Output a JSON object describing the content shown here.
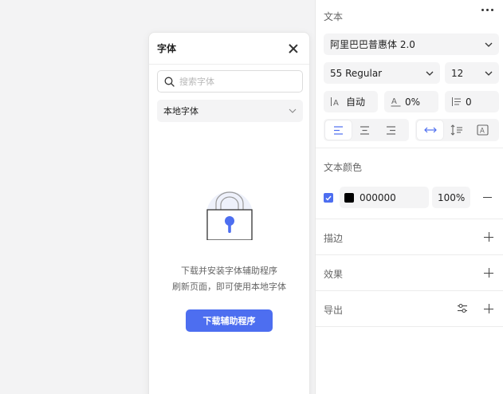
{
  "font_panel": {
    "title": "字体",
    "search_placeholder": "搜索字体",
    "source_selected": "本地字体",
    "message_line1": "下载并安装字体辅助程序",
    "message_line2": "刷新页面，即可使用本地字体",
    "download_button": "下载辅助程序"
  },
  "text_panel": {
    "section_title": "文本",
    "font_family": "阿里巴巴普惠体 2.0",
    "font_weight": "55 Regular",
    "font_size": "12",
    "line_height": "自动",
    "letter_spacing": "0%",
    "paragraph_spacing": "0",
    "align_options": [
      "left",
      "center",
      "right"
    ],
    "align_selected": "left",
    "resize_options": [
      "auto-width",
      "auto-height",
      "fixed"
    ],
    "resize_selected": "auto-width",
    "accent_color": "#4d6ef0"
  },
  "text_color": {
    "section_title": "文本颜色",
    "enabled": true,
    "hex": "000000",
    "opacity": "100%",
    "swatch_color": "#000000"
  },
  "stroke": {
    "title": "描边"
  },
  "effects": {
    "title": "效果"
  },
  "export": {
    "title": "导出"
  }
}
